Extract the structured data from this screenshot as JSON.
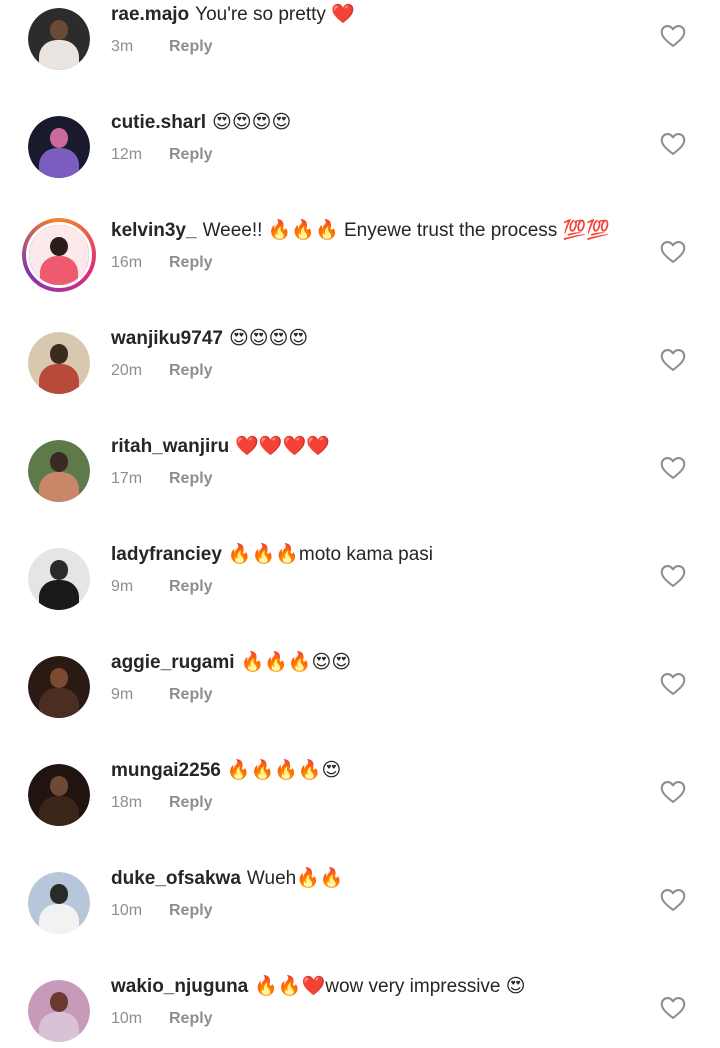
{
  "comments": [
    {
      "username": "rae.majo",
      "text": "You're so pretty ❤️",
      "time": "3m",
      "reply": "Reply",
      "avatar_colors": [
        "#2c2c2c",
        "#6b4a3a",
        "#e9e4df"
      ]
    },
    {
      "username": "cutie.sharl",
      "text": "😍😍😍😍",
      "time": "12m",
      "reply": "Reply",
      "avatar_colors": [
        "#1a1a2e",
        "#c96a9f",
        "#7b5cbf"
      ]
    },
    {
      "username": "kelvin3y_",
      "text": "Weee!! 🔥🔥🔥 Enyewe trust the process 💯💯",
      "time": "16m",
      "reply": "Reply",
      "avatar_colors": [
        "#fde8ec",
        "#2b1d1a",
        "#ef5b6e"
      ]
    },
    {
      "username": "wanjiku9747",
      "text": "😍😍😍😍",
      "time": "20m",
      "reply": "Reply",
      "avatar_colors": [
        "#d8c8b0",
        "#3b2a20",
        "#b84a3c"
      ]
    },
    {
      "username": "ritah_wanjiru",
      "text": "❤️❤️❤️❤️",
      "time": "17m",
      "reply": "Reply",
      "avatar_colors": [
        "#5e7a4a",
        "#3a2a22",
        "#c9876a"
      ]
    },
    {
      "username": "ladyfranciey",
      "text": "🔥🔥🔥moto kama pasi",
      "time": "9m",
      "reply": "Reply",
      "avatar_colors": [
        "#e5e5e5",
        "#2a2a2a",
        "#1a1a1a"
      ]
    },
    {
      "username": "aggie_rugami",
      "text": "🔥🔥🔥😍😍",
      "time": "9m",
      "reply": "Reply",
      "avatar_colors": [
        "#2b1a14",
        "#7a4a32",
        "#4a2e22"
      ]
    },
    {
      "username": "mungai2256",
      "text": "🔥🔥🔥🔥😍",
      "time": "18m",
      "reply": "Reply",
      "avatar_colors": [
        "#1f1410",
        "#6e4a36",
        "#3b2418"
      ]
    },
    {
      "username": "duke_ofsakwa",
      "text": "Wueh🔥🔥",
      "time": "10m",
      "reply": "Reply",
      "avatar_colors": [
        "#b7c6d8",
        "#2a2a2a",
        "#f2f2f2"
      ]
    },
    {
      "username": "wakio_njuguna",
      "text": "🔥🔥❤️wow very impressive 😍",
      "time": "10m",
      "reply": "Reply",
      "avatar_colors": [
        "#c69ab8",
        "#6a3a30",
        "#d9c2d6"
      ]
    }
  ],
  "colors": {
    "username": "#262626",
    "meta": "#8e8e8e",
    "heart_outline": "#8e8e8e",
    "story_ring": [
      "#f58529",
      "#dd2a7b",
      "#8134af"
    ]
  },
  "icons": {
    "like": "heart-outline-icon"
  }
}
